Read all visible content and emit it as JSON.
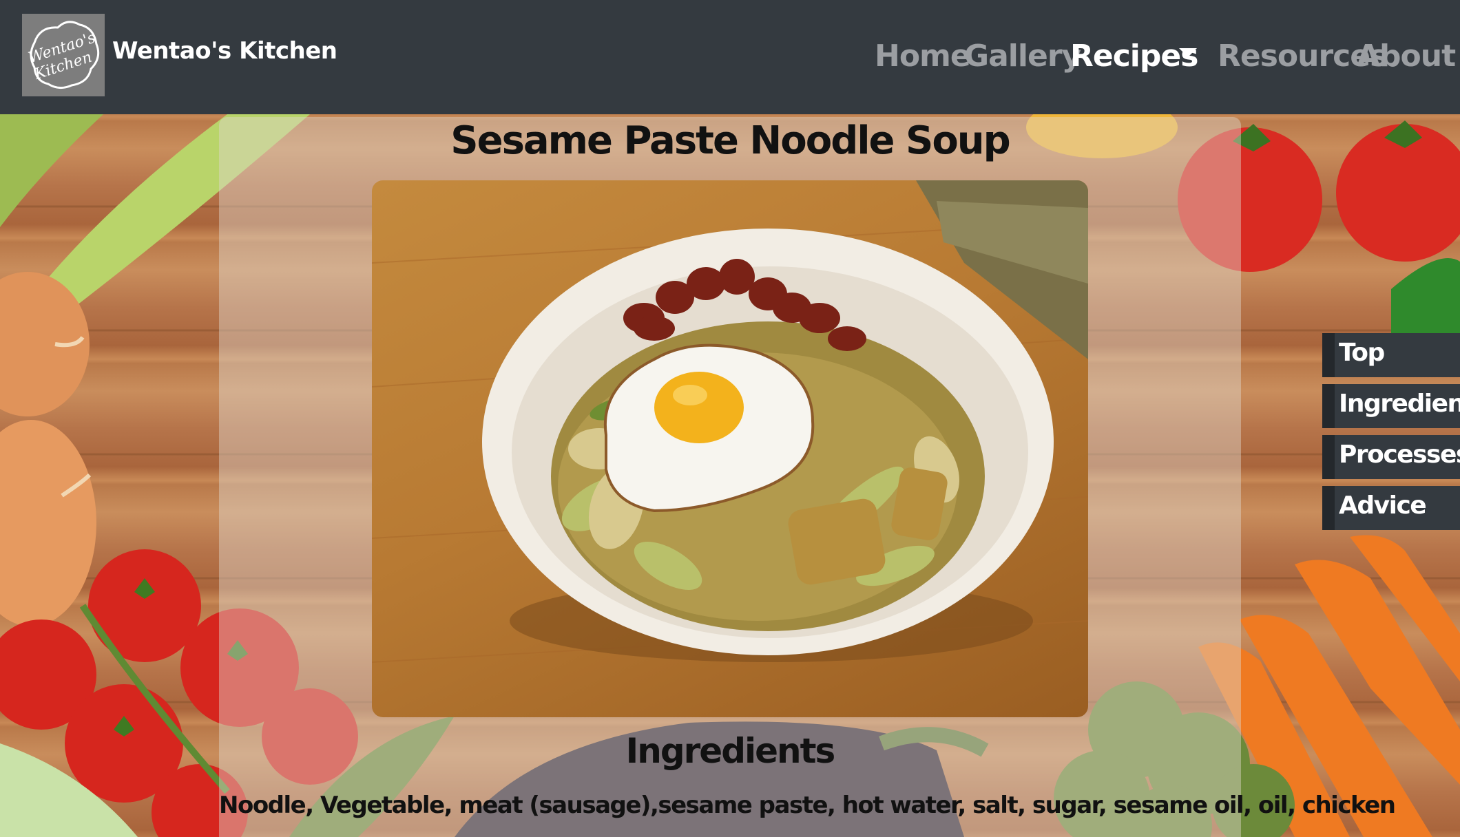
{
  "brand": {
    "logo_text_line1": "Wentao's",
    "logo_text_line2": "Kitchen",
    "name": "Wentao's Kitchen"
  },
  "nav": {
    "items": [
      {
        "label": "Home",
        "active": false
      },
      {
        "label": "Gallery",
        "active": false
      },
      {
        "label": "Recipes",
        "active": true,
        "dropdown": true
      },
      {
        "label": "Resources",
        "active": false
      },
      {
        "label": "About",
        "active": false
      }
    ]
  },
  "recipe": {
    "title": "Sesame Paste Noodle Soup",
    "photo_icon": "noodle-soup-photo"
  },
  "ingredients": {
    "heading": "Ingredients",
    "text": "Noodle, Vegetable, meat (sausage),sesame paste, hot water, salt, sugar, sesame oil, oil, chicken"
  },
  "sidenav": {
    "items": [
      "Top",
      "Ingredients",
      "Processes",
      "Advice"
    ]
  },
  "colors": {
    "navbar": "#343a40",
    "nav_inactive": "#9b9ea2",
    "nav_active": "#ffffff"
  }
}
